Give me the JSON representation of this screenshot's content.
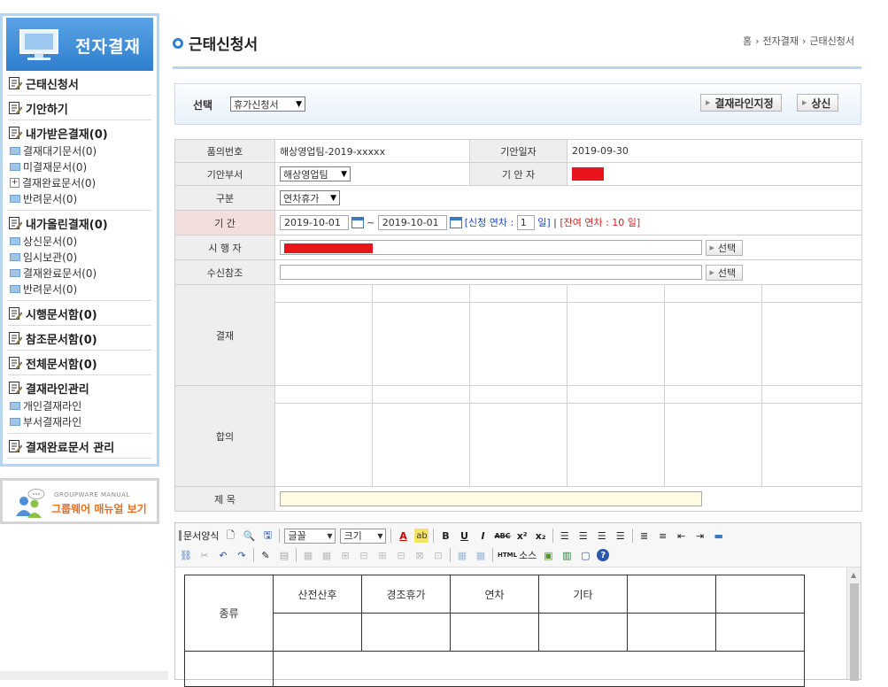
{
  "sidebar": {
    "header_title": "전자결재",
    "groups": [
      {
        "title": "근태신청서",
        "items": []
      },
      {
        "title": "기안하기",
        "items": []
      },
      {
        "title": "내가받은결재(0)",
        "items": [
          "결재대기문서(0)",
          "미결재문서(0)",
          "결재완료문서(0)",
          "반려문서(0)"
        ]
      },
      {
        "title": "내가올린결재(0)",
        "items": [
          "상신문서(0)",
          "임시보관(0)",
          "결재완료문서(0)",
          "반려문서(0)"
        ]
      },
      {
        "title": "시행문서함(0)",
        "items": []
      },
      {
        "title": "참조문서함(0)",
        "items": []
      },
      {
        "title": "전체문서함(0)",
        "items": []
      },
      {
        "title": "결재라인관리",
        "items": [
          "개인결재라인",
          "부서결재라인"
        ]
      },
      {
        "title": "결재완료문서 관리",
        "items": []
      }
    ],
    "manual_small": "GROUPWARE MANUAL",
    "manual_big": "그룹웨어 매뉴얼 보기"
  },
  "header": {
    "title": "근태신청서",
    "breadcrumb": [
      "홈",
      "전자결재",
      "근태신청서"
    ]
  },
  "select_bar": {
    "label": "선택",
    "doc_type": "휴가신청서",
    "approval_line_button": "결재라인지정",
    "submit_button": "상신"
  },
  "form": {
    "doc_no_label": "품의번호",
    "doc_no": "해상영업팀-2019-xxxxx",
    "draft_date_label": "기안일자",
    "draft_date": "2019-09-30",
    "dept_label": "기안부서",
    "dept": "해상영업팀",
    "drafter_label": "기 안 자",
    "category_label": "구분",
    "category": "연차휴가",
    "period_label": "기 간",
    "start_date": "2019-10-01",
    "tilde": "~",
    "end_date": "2019-10-01",
    "apply_prefix": "[신청 연차 :",
    "apply_days": "1",
    "apply_suffix": "일]",
    "remain_sep": "|",
    "remain_text": "[잔여 연차 : 10 일]",
    "executor_label": "시 행 자",
    "select_button": "선택",
    "receiver_label": "수신참조",
    "approval_label": "결재",
    "agreement_label": "합의",
    "subject_label": "제 목"
  },
  "editor": {
    "doc_format": "문서양식",
    "font_select": "글꼴",
    "size_select": "크기",
    "html_source": "소스",
    "table": {
      "row_header": "종류",
      "columns": [
        "산전산후",
        "경조휴가",
        "연차",
        "기타",
        "",
        ""
      ]
    }
  }
}
